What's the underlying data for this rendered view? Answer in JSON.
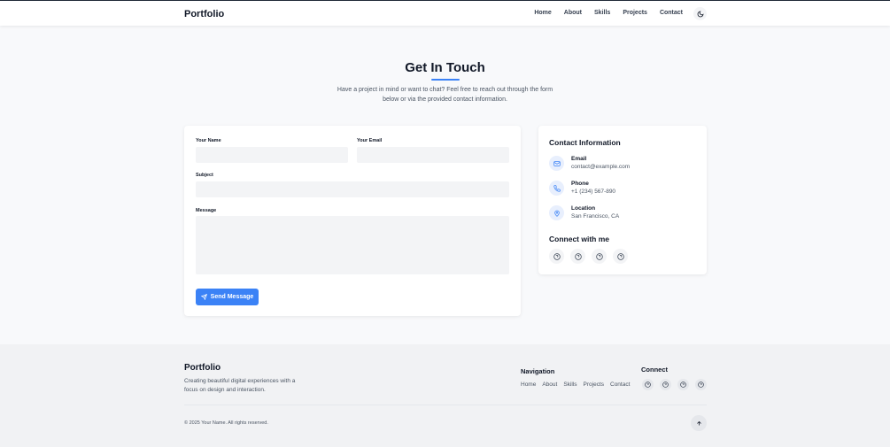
{
  "header": {
    "brand": "Portfolio",
    "nav": [
      "Home",
      "About",
      "Skills",
      "Projects",
      "Contact"
    ],
    "theme_icon": "moon-icon"
  },
  "hero": {
    "title": "Get In Touch",
    "text": "Have a project in mind or want to chat? Feel free to reach out through the form below or via the provided contact information."
  },
  "form": {
    "name_label": "Your Name",
    "email_label": "Your Email",
    "subject_label": "Subject",
    "message_label": "Message",
    "send_label": "Send Message"
  },
  "contact_info": {
    "title": "Contact Information",
    "items": [
      {
        "label": "Email",
        "value": "contact@example.com",
        "icon": "mail-icon"
      },
      {
        "label": "Phone",
        "value": "+1 (234) 567-890",
        "icon": "phone-icon"
      },
      {
        "label": "Location",
        "value": "San Francisco, CA",
        "icon": "location-pin-icon"
      }
    ],
    "connect_title": "Connect with me",
    "social_icons": [
      "help-circle-icon",
      "help-circle-icon",
      "help-circle-icon",
      "help-circle-icon"
    ]
  },
  "footer": {
    "brand": "Portfolio",
    "tagline": "Creating beautiful digital experiences with a focus on design and interaction.",
    "nav_title": "Navigation",
    "nav": [
      "Home",
      "About",
      "Skills",
      "Projects",
      "Contact"
    ],
    "connect_title": "Connect",
    "copyright": "© 2025 Your Name. All rights reserved."
  },
  "colors": {
    "accent": "#3b82f6",
    "background": "#f8f9fb",
    "footer_bg": "#f1f2f4"
  }
}
